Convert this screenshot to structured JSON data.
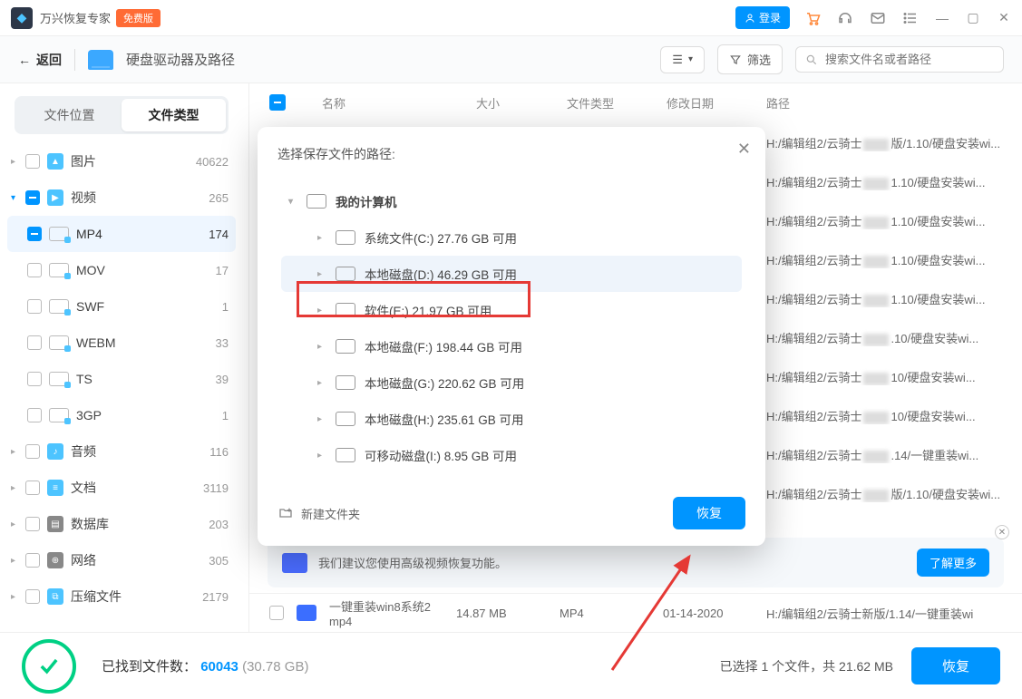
{
  "titlebar": {
    "app_name": "万兴恢复专家",
    "free_badge": "免费版",
    "login": "登录"
  },
  "toolbar": {
    "back": "返回",
    "breadcrumb": "硬盘驱动器及路径",
    "filter": "筛选",
    "search_placeholder": "搜索文件名或者路径"
  },
  "segments": {
    "loc": "文件位置",
    "type": "文件类型"
  },
  "tree": {
    "image": {
      "label": "图片",
      "count": "40622"
    },
    "video": {
      "label": "视频",
      "count": "265"
    },
    "mp4": {
      "label": "MP4",
      "count": "174"
    },
    "mov": {
      "label": "MOV",
      "count": "17"
    },
    "swf": {
      "label": "SWF",
      "count": "1"
    },
    "webm": {
      "label": "WEBM",
      "count": "33"
    },
    "ts": {
      "label": "TS",
      "count": "39"
    },
    "gp3": {
      "label": "3GP",
      "count": "1"
    },
    "audio": {
      "label": "音频",
      "count": "116"
    },
    "doc": {
      "label": "文档",
      "count": "3119"
    },
    "db": {
      "label": "数据库",
      "count": "203"
    },
    "net": {
      "label": "网络",
      "count": "305"
    },
    "zip": {
      "label": "压缩文件",
      "count": "2179"
    }
  },
  "columns": {
    "name": "名称",
    "size": "大小",
    "type": "文件类型",
    "date": "修改日期",
    "path": "路径"
  },
  "rows": {
    "p0": "H:/编辑组2/云骑士",
    "s0": "版/1.10/硬盘安装wi...",
    "p1": "H:/编辑组2/云骑士",
    "s1": "1.10/硬盘安装wi...",
    "p2": "H:/编辑组2/云骑士",
    "s2": "1.10/硬盘安装wi...",
    "p3": "H:/编辑组2/云骑士",
    "s3": "1.10/硬盘安装wi...",
    "p4": "H:/编辑组2/云骑士",
    "s4": "1.10/硬盘安装wi...",
    "p5": "H:/编辑组2/云骑士",
    "s5": ".10/硬盘安装wi...",
    "p6": "H:/编辑组2/云骑士",
    "s6": "10/硬盘安装wi...",
    "p7": "H:/编辑组2/云骑士",
    "s7": "10/硬盘安装wi...",
    "p8": "H:/编辑组2/云骑士",
    "s8": ".14/一键重装wi...",
    "p9": "H:/编辑组2/云骑士",
    "s9": "版/1.10/硬盘安装wi..."
  },
  "hint": {
    "text": "我们建议您使用高级视频恢复功能。",
    "learn": "了解更多"
  },
  "lastrow": {
    "name": "一键重装win8系统2 mp4",
    "size": "14.87 MB",
    "type": "MP4",
    "date": "01-14-2020",
    "path": "H:/编辑组2/云骑士新版/1.14/一键重装wi"
  },
  "footer": {
    "found_label": "已找到文件数：",
    "found_num": "60043",
    "found_size": "(30.78 GB)",
    "selected": "已选择 1 个文件，共 21.62 MB",
    "recover": "恢复"
  },
  "modal": {
    "title": "选择保存文件的路径:",
    "root": "我的计算机",
    "c": "系统文件(C:)  27.76 GB 可用",
    "d": "本地磁盘(D:)  46.29 GB 可用",
    "e": "软件(E:)  21.97 GB 可用",
    "f": "本地磁盘(F:)  198.44 GB 可用",
    "g": "本地磁盘(G:)  220.62 GB 可用",
    "h": "本地磁盘(H:)  235.61 GB 可用",
    "i": "可移动磁盘(I:)  8.95 GB 可用",
    "newfolder": "新建文件夹",
    "recover": "恢复"
  }
}
